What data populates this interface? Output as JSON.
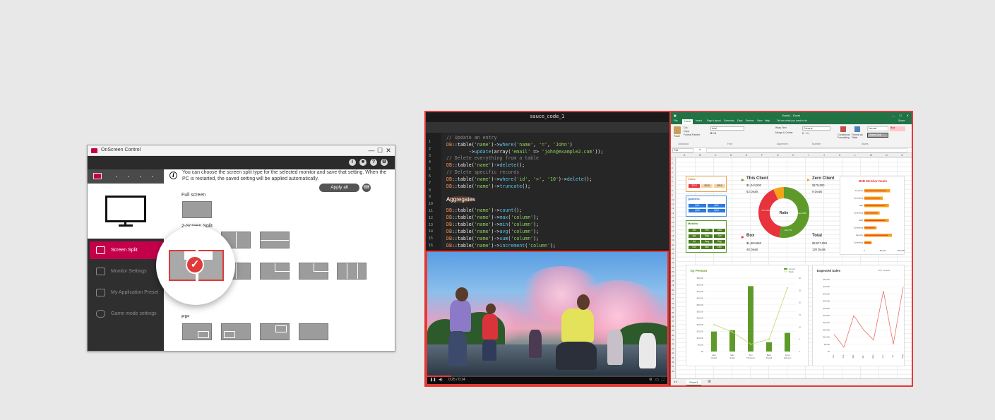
{
  "osc": {
    "title": "OnScreen Control",
    "window_min": "—",
    "window_max": "☐",
    "window_close": "✕",
    "top_icons": [
      "i",
      "■",
      "?",
      "⚙"
    ],
    "info_text": "You can choose the screen split type for the selected monitor and save that setting. When the PC is restarted, the saved setting will be applied automatically.",
    "apply_all": "Apply all",
    "nav": [
      {
        "label": "Screen Split",
        "active": true
      },
      {
        "label": "Monitor Settings",
        "active": false
      },
      {
        "label": "My Application Preset",
        "active": false
      },
      {
        "label": "Game mode settings",
        "active": false
      }
    ],
    "sections": {
      "full": "Full screen",
      "two": "2-Screen Split",
      "pip": "PIP"
    }
  },
  "code": {
    "title": "sauce_code_1",
    "line_numbers": [
      "1",
      "2",
      "3",
      "4",
      "5",
      "6",
      "7",
      "8",
      "9",
      "10",
      "11",
      "12",
      "13",
      "14",
      "15",
      "16"
    ],
    "lines": [
      {
        "type": "cmt",
        "text": "// Update an entry"
      },
      {
        "type": "code",
        "text": "DB::table('name')->where('name', '=', 'John')"
      },
      {
        "type": "code",
        "text": "        ->update(array('email' => 'john@example2.com'));"
      },
      {
        "type": "cmt",
        "text": "// Delete everything from a table"
      },
      {
        "type": "code",
        "text": "DB::table('name')->delete();"
      },
      {
        "type": "cmt",
        "text": "// Delete specific records"
      },
      {
        "type": "code",
        "text": "DB::table('name')->where('id', '>', '10')->delete();"
      },
      {
        "type": "code",
        "text": "DB::table('name')->truncate();"
      },
      {
        "type": "head",
        "text": "Aggregates"
      },
      {
        "type": "code",
        "text": "DB::table('name')->count();"
      },
      {
        "type": "code",
        "text": "DB::table('name')->max('column');"
      },
      {
        "type": "code",
        "text": "DB::table('name')->min('column');"
      },
      {
        "type": "code",
        "text": "DB::table('name')->avg('column');"
      },
      {
        "type": "code",
        "text": "DB::table('name')->sum('column');"
      },
      {
        "type": "code",
        "text": "DB::table('name')->increment('column');"
      }
    ]
  },
  "video": {
    "time": "0:25 / 0:14",
    "progress": 0.1
  },
  "excel": {
    "title": "Book1 - Excel",
    "tabs": [
      "File",
      "Home",
      "Insert",
      "Page Layout",
      "Formulas",
      "Data",
      "Review",
      "View",
      "Help"
    ],
    "tell_me": "Tell me what you want to do",
    "share": "Share",
    "ribbon": {
      "paste": "Paste",
      "cut": "Cut",
      "copy": "Copy",
      "format_painter": "Format Painter",
      "font": "Arial",
      "wrap_text": "Wrap Text",
      "merge_center": "Merge & Center",
      "number_format": "General",
      "cond_format": "Conditional Formatting",
      "format_as_table": "Format as Table",
      "style_normal": "Normal",
      "style_bad": "Bad",
      "style_check": "Check Cell",
      "groups": [
        "Clipboard",
        "Font",
        "Alignment",
        "Number",
        "Styles"
      ]
    },
    "name_box": "F10",
    "columns": [
      "A",
      "B",
      "C",
      "D",
      "E",
      "F",
      "G",
      "H",
      "I",
      "J",
      "K",
      "L",
      "M",
      "N",
      "O"
    ],
    "sheet_tab": "Sheet1",
    "slicers": {
      "years": {
        "title": "Years",
        "items": [
          "2014",
          "2013",
          "2012"
        ]
      },
      "quarters": {
        "title": "Quarters",
        "items": [
          "Qtr1",
          "Qtr2",
          "Qtr3",
          "Qtr4"
        ]
      },
      "months": {
        "title": "Months",
        "items": [
          "Jan",
          "Feb",
          "Mar",
          "Apr",
          "May",
          "Jun",
          "Jul",
          "Aug",
          "Sep",
          "Oct",
          "Nov",
          "Dec"
        ]
      }
    },
    "kpi": {
      "this_client": {
        "name": "This Client",
        "amount": "$1,044,500",
        "deals": "63 Deals"
      },
      "zero_client": {
        "name": "Zero Client",
        "amount": "$178,500",
        "deals": "9 Deals"
      },
      "box": {
        "name": "Box",
        "amount": "$1,354,650",
        "deals": "48 Deals"
      },
      "total": {
        "name": "Total",
        "amount": "$2,577,050",
        "deals": "120 Deals"
      },
      "donut_center": "Ratio",
      "donut_labels": [
        "Thin 53%",
        "Laxi 40%",
        "Zero 7%"
      ]
    },
    "colors": {
      "green": "#5e9a2a",
      "red": "#e8323c",
      "orange": "#f5a31a",
      "excel": "#217346"
    }
  },
  "chart_data": [
    {
      "type": "bar",
      "title": "B2B Monitor Deals",
      "categories": [
        "Amphora",
        "Consulting",
        "VED",
        "Consulting",
        "OED",
        "Consulting",
        "Security",
        "Consulting"
      ],
      "series": [
        {
          "values": [
            42,
            30,
            40,
            25,
            40,
            20,
            45,
            12
          ]
        }
      ],
      "xlim": [
        0,
        60
      ]
    },
    {
      "type": "bar",
      "title": "by Person",
      "categories": [
        "Alex Grand",
        "Sam Smith",
        "Tom Thomson",
        "Betty Powell",
        "Anna Johnson"
      ],
      "series": [
        {
          "name": "Amount",
          "values": [
            15000,
            16000,
            49000,
            7000,
            14000
          ]
        },
        {
          "name": "Deals",
          "values": [
            11,
            8,
            3,
            5,
            26
          ]
        }
      ],
      "ylim": [
        0,
        55000
      ],
      "y2lim": [
        0,
        30
      ]
    },
    {
      "type": "line",
      "title": "Expected Sales",
      "categories": [
        "Jan",
        "Feb",
        "Mar",
        "Apr",
        "May",
        "Jun",
        "Jul",
        "Aug"
      ],
      "series": [
        {
          "name": "Amount",
          "values": [
            12000,
            3000,
            25000,
            15000,
            8000,
            42000,
            5000,
            45000
          ]
        }
      ],
      "ylim": [
        0,
        50000
      ]
    }
  ]
}
